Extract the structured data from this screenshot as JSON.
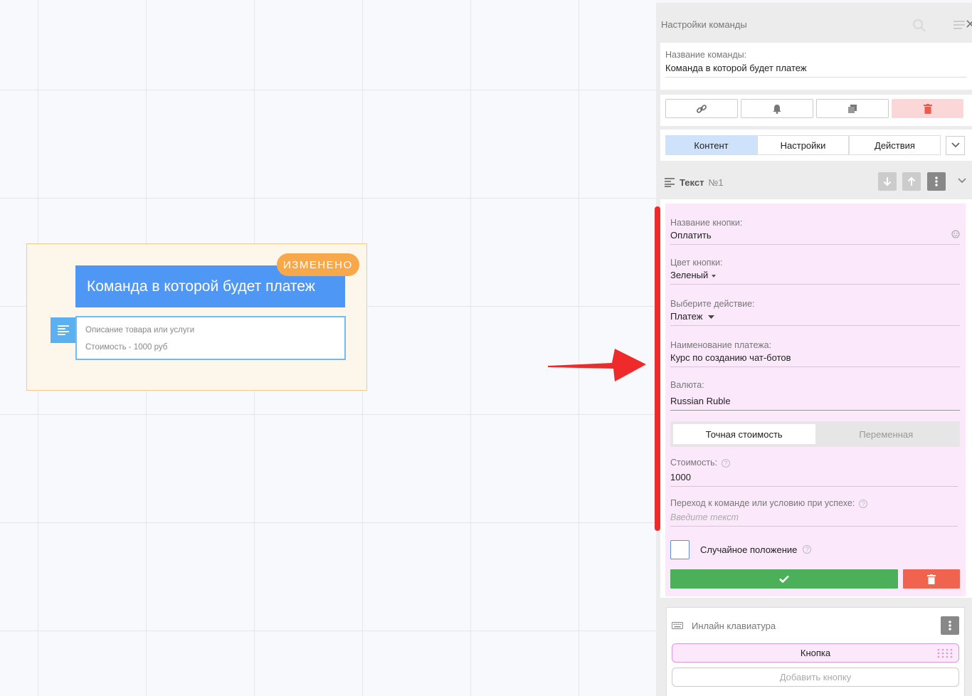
{
  "node": {
    "title": "Команда в которой будет платеж",
    "badge": "ИЗМЕНЕНО",
    "text_lines": [
      "Описание товара или услуги",
      "Стоимость - 1000 руб"
    ]
  },
  "panel": {
    "header_title": "Настройки команды",
    "command_name_label": "Название команды:",
    "command_name_value": "Команда в которой будет платеж",
    "tabs": [
      "Контент",
      "Настройки",
      "Действия"
    ],
    "active_tab": "Контент",
    "section_title": "Текст",
    "section_number": "№1",
    "form": {
      "button_name_label": "Название кнопки:",
      "button_name_value": "Оплатить",
      "button_color_label": "Цвет кнопки:",
      "button_color_value": "Зеленый",
      "action_label": "Выберите действие:",
      "action_value": "Платеж",
      "payment_name_label": "Наименование платежа:",
      "payment_name_value": "Курс по созданию чат-ботов",
      "currency_label": "Валюта:",
      "currency_value": "Russian Ruble",
      "price_mode_options": [
        "Точная стоимость",
        "Переменная"
      ],
      "price_mode_selected": "Точная стоимость",
      "price_label": "Стоимость:",
      "price_value": "1000",
      "success_label": "Переход к команде или условию при успехе:",
      "success_placeholder": "Введите текст",
      "random_label": "Случайное положение"
    },
    "keyboard": {
      "title": "Инлайн клавиатура",
      "button_label": "Кнопка",
      "add_button_label": "Добавить кнопку"
    }
  },
  "colors": {
    "accent_blue": "#4f97f5",
    "badge_orange": "#f7a84a",
    "save_green": "#4cb05a",
    "delete_red": "#f0634f",
    "annotation_red": "#ee2a2a",
    "form_pink": "#fbe9fb"
  },
  "icons": {
    "toolbar": [
      "link-icon",
      "bell-icon",
      "copy-icon",
      "trash-icon"
    ],
    "header": [
      "search-icon",
      "menu-icon",
      "close-icon"
    ]
  }
}
